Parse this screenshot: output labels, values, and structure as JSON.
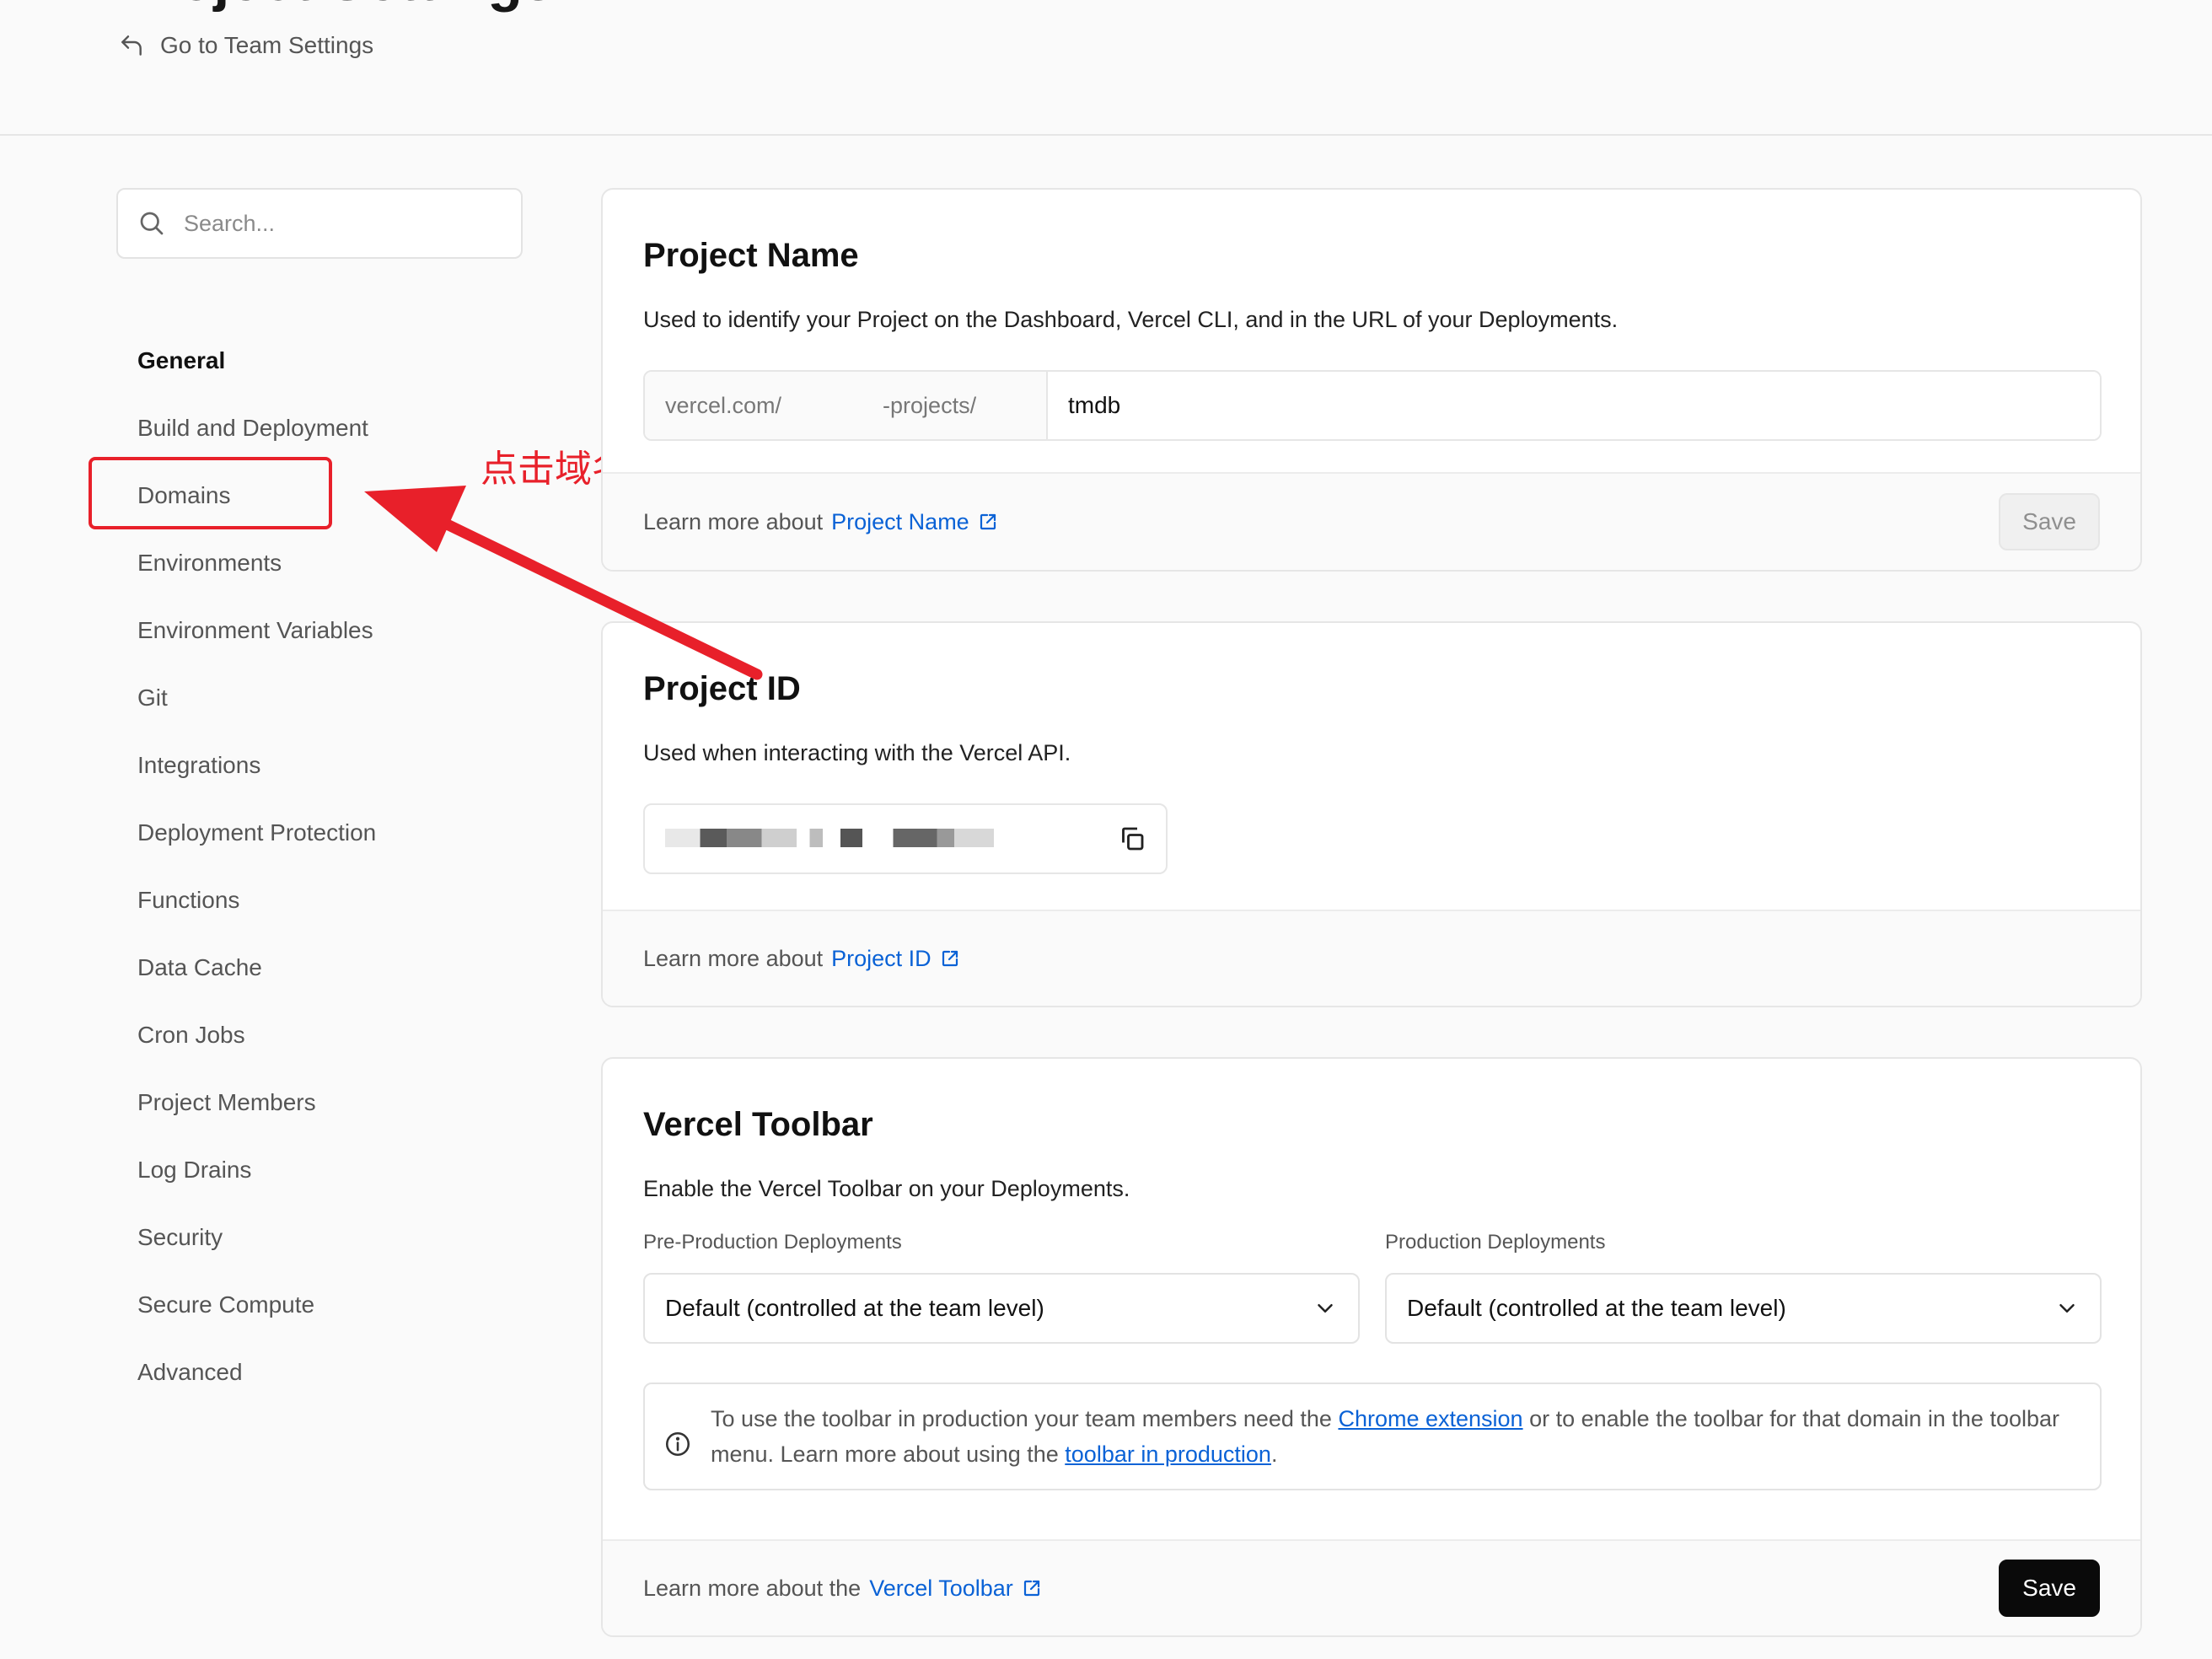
{
  "header": {
    "title_fragment": "Project Settings",
    "back_link": "Go to Team Settings"
  },
  "sidebar": {
    "search_placeholder": "Search...",
    "items": [
      {
        "label": "General",
        "active": true
      },
      {
        "label": "Build and Deployment"
      },
      {
        "label": "Domains"
      },
      {
        "label": "Environments"
      },
      {
        "label": "Environment Variables"
      },
      {
        "label": "Git"
      },
      {
        "label": "Integrations"
      },
      {
        "label": "Deployment Protection"
      },
      {
        "label": "Functions"
      },
      {
        "label": "Data Cache"
      },
      {
        "label": "Cron Jobs"
      },
      {
        "label": "Project Members"
      },
      {
        "label": "Log Drains"
      },
      {
        "label": "Security"
      },
      {
        "label": "Secure Compute"
      },
      {
        "label": "Advanced"
      }
    ]
  },
  "annotation": {
    "text": "点击域名选项",
    "color": "#e8202a"
  },
  "project_name": {
    "title": "Project Name",
    "description": "Used to identify your Project on the Dashboard, Vercel CLI, and in the URL of your Deployments.",
    "url_prefix_start": "vercel.com/",
    "url_prefix_end": "-projects/",
    "value": "tmdb",
    "learn_prefix": "Learn more about",
    "learn_link": "Project Name",
    "save_label": "Save"
  },
  "project_id": {
    "title": "Project ID",
    "description": "Used when interacting with the Vercel API.",
    "learn_prefix": "Learn more about",
    "learn_link": "Project ID"
  },
  "vercel_toolbar": {
    "title": "Vercel Toolbar",
    "description": "Enable the Vercel Toolbar on your Deployments.",
    "pre_production_label": "Pre-Production Deployments",
    "pre_production_value": "Default (controlled at the team level)",
    "production_label": "Production Deployments",
    "production_value": "Default (controlled at the team level)",
    "info_text_1": "To use the toolbar in production your team members need the",
    "info_link_1": "Chrome extension",
    "info_text_2": "or to enable the toolbar for that domain in the toolbar menu. Learn more about using the",
    "info_link_2": "toolbar in production",
    "info_text_3": ".",
    "learn_prefix": "Learn more about the",
    "learn_link": "Vercel Toolbar",
    "save_label": "Save"
  },
  "colors": {
    "link": "#0a62d6",
    "accent_red": "#e8202a",
    "primary_button": "#0a0a0a"
  }
}
